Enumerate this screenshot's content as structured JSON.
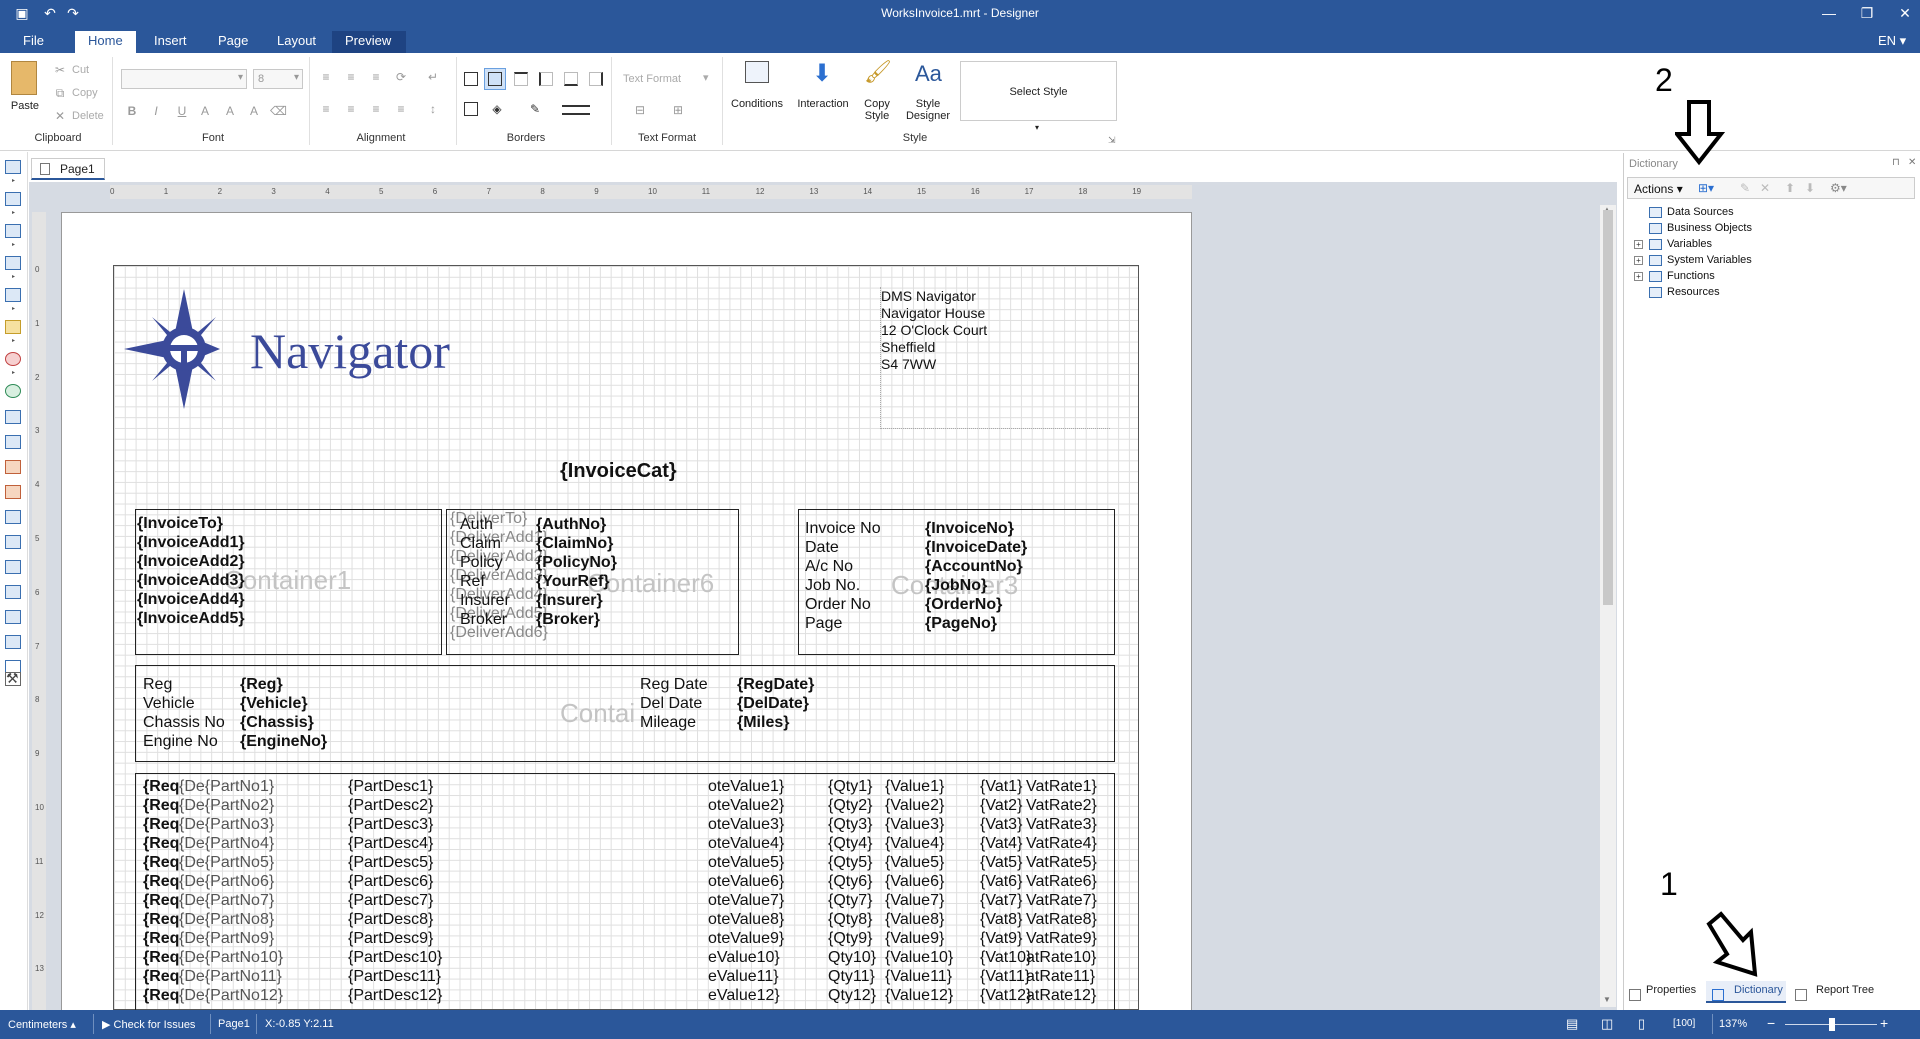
{
  "window": {
    "title": "WorksInvoice1.mrt - Designer",
    "lang": "EN"
  },
  "menu": {
    "tabs": [
      "File",
      "Home",
      "Insert",
      "Page",
      "Layout",
      "Preview"
    ],
    "active": "Home"
  },
  "ribbon": {
    "clipboard": {
      "paste": "Paste",
      "cut": "Cut",
      "copy": "Copy",
      "delete": "Delete",
      "label": "Clipboard"
    },
    "font": {
      "size": "8",
      "label": "Font"
    },
    "alignment": {
      "label": "Alignment"
    },
    "borders": {
      "label": "Borders"
    },
    "text_format": {
      "combo": "Text Format",
      "label": "Text Format"
    },
    "style": {
      "conditions": "Conditions",
      "interaction": "Interaction",
      "copy_style_1": "Copy",
      "copy_style_2": "Style",
      "style_designer_1": "Style",
      "style_designer_2": "Designer",
      "select_style": "Select Style",
      "label": "Style"
    }
  },
  "page_tab": "Page1",
  "ruler": {
    "h": [
      "0",
      "1",
      "2",
      "3",
      "4",
      "5",
      "6",
      "7",
      "8",
      "9",
      "10",
      "11",
      "12",
      "13",
      "14",
      "15",
      "16",
      "17",
      "18",
      "19"
    ],
    "v": [
      "0",
      "1",
      "2",
      "3",
      "4",
      "5",
      "6",
      "7",
      "8",
      "9",
      "10",
      "11",
      "12",
      "13"
    ]
  },
  "report": {
    "logo_text": "Navigator",
    "address": [
      "DMS Navigator",
      "Navigator House",
      "12 O'Clock Court",
      "Sheffield",
      "S4 7WW"
    ],
    "invoice_cat": "{InvoiceCat}",
    "invoice_to": [
      "{InvoiceTo}",
      "{InvoiceAdd1}",
      "{InvoiceAdd2}",
      "{InvoiceAdd3}",
      "{InvoiceAdd4}",
      "{InvoiceAdd5}"
    ],
    "container1": "Container1",
    "deliver_to": [
      "{DeliverTo}",
      "{DeliverAdd1}",
      "{DeliverAdd2}",
      "{DeliverAdd3}",
      "{DeliverAdd4}",
      "{DeliverAdd5}",
      "{DeliverAdd6}"
    ],
    "auth_labels": [
      "Auth",
      "Claim",
      "Policy",
      "Ref",
      "Insurer",
      "Broker"
    ],
    "auth_values": [
      "{AuthNo}",
      "{ClaimNo}",
      "{PolicyNo}",
      "{YourRef}",
      "{Insurer}",
      "{Broker}"
    ],
    "container6": "Container6",
    "invoice_labels": [
      "Invoice No",
      "Date",
      "A/c No",
      "Job No.",
      "Order No",
      "Page"
    ],
    "invoice_values": [
      "{InvoiceNo}",
      "{InvoiceDate}",
      "{AccountNo}",
      "{JobNo}",
      "{OrderNo}",
      "{PageNo}"
    ],
    "container3": "Container3",
    "vehicle_labels": [
      "Reg",
      "Vehicle",
      "Chassis No",
      "Engine No"
    ],
    "vehicle_values": [
      "{Reg}",
      "{Vehicle}",
      "{Chassis}",
      "{EngineNo}"
    ],
    "vehicle2_labels": [
      "Reg Date",
      "Del Date",
      "Mileage"
    ],
    "vehicle2_values": [
      "{RegDate}",
      "{DelDate}",
      "{Miles}"
    ],
    "container_ghost": "Contai",
    "rows": [
      {
        "req": "{Req",
        "part": "{De{PartNo1}",
        "desc": "{PartDesc1}",
        "val": "oteValue1}",
        "qty": "{Qty1}",
        "value": "{Value1}",
        "vat": "{Vat1}",
        "rate": "VatRate1}"
      },
      {
        "req": "{Req",
        "part": "{De{PartNo2}",
        "desc": "{PartDesc2}",
        "val": "oteValue2}",
        "qty": "{Qty2}",
        "value": "{Value2}",
        "vat": "{Vat2}",
        "rate": "VatRate2}"
      },
      {
        "req": "{Req",
        "part": "{De{PartNo3}",
        "desc": "{PartDesc3}",
        "val": "oteValue3}",
        "qty": "{Qty3}",
        "value": "{Value3}",
        "vat": "{Vat3}",
        "rate": "VatRate3}"
      },
      {
        "req": "{Req",
        "part": "{De{PartNo4}",
        "desc": "{PartDesc4}",
        "val": "oteValue4}",
        "qty": "{Qty4}",
        "value": "{Value4}",
        "vat": "{Vat4}",
        "rate": "VatRate4}"
      },
      {
        "req": "{Req",
        "part": "{De{PartNo5}",
        "desc": "{PartDesc5}",
        "val": "oteValue5}",
        "qty": "{Qty5}",
        "value": "{Value5}",
        "vat": "{Vat5}",
        "rate": "VatRate5}"
      },
      {
        "req": "{Req",
        "part": "{De{PartNo6}",
        "desc": "{PartDesc6}",
        "val": "oteValue6}",
        "qty": "{Qty6}",
        "value": "{Value6}",
        "vat": "{Vat6}",
        "rate": "VatRate6}"
      },
      {
        "req": "{Req",
        "part": "{De{PartNo7}",
        "desc": "{PartDesc7}",
        "val": "oteValue7}",
        "qty": "{Qty7}",
        "value": "{Value7}",
        "vat": "{Vat7}",
        "rate": "VatRate7}"
      },
      {
        "req": "{Req",
        "part": "{De{PartNo8}",
        "desc": "{PartDesc8}",
        "val": "oteValue8}",
        "qty": "{Qty8}",
        "value": "{Value8}",
        "vat": "{Vat8}",
        "rate": "VatRate8}"
      },
      {
        "req": "{Req",
        "part": "{De{PartNo9}",
        "desc": "{PartDesc9}",
        "val": "oteValue9}",
        "qty": "{Qty9}",
        "value": "{Value9}",
        "vat": "{Vat9}",
        "rate": "VatRate9}"
      },
      {
        "req": "{Req",
        "part": "{De{PartNo10}",
        "desc": "{PartDesc10}",
        "val": "eValue10}",
        "qty": "Qty10}",
        "value": "{Value10}",
        "vat": "{Vat10}",
        "rate": "atRate10}"
      },
      {
        "req": "{Req",
        "part": "{De{PartNo11}",
        "desc": "{PartDesc11}",
        "val": "eValue11}",
        "qty": "Qty11}",
        "value": "{Value11}",
        "vat": "{Vat11}",
        "rate": "atRate11}"
      },
      {
        "req": "{Req",
        "part": "{De{PartNo12}",
        "desc": "{PartDesc12}",
        "val": "eValue12}",
        "qty": "Qty12}",
        "value": "{Value12}",
        "vat": "{Vat12}",
        "rate": "atRate12}"
      }
    ]
  },
  "dictionary": {
    "title": "Dictionary",
    "actions": "Actions",
    "items": [
      "Data Sources",
      "Business Objects",
      "Variables",
      "System Variables",
      "Functions",
      "Resources"
    ],
    "icons": [
      "data-sources-icon",
      "business-objects-icon",
      "variables-icon",
      "system-variables-icon",
      "functions-icon",
      "resources-icon"
    ]
  },
  "bottom_tabs": [
    "Properties",
    "Dictionary",
    "Report Tree"
  ],
  "annotations": {
    "one": "1",
    "two": "2"
  },
  "status": {
    "units": "Centimeters",
    "check": "Check for Issues",
    "page": "Page1",
    "coords": "X:-0.85 Y:2.11",
    "zoom": "137%"
  },
  "colors": {
    "accent": "#2b579a",
    "logo": "#3b4a9a"
  }
}
